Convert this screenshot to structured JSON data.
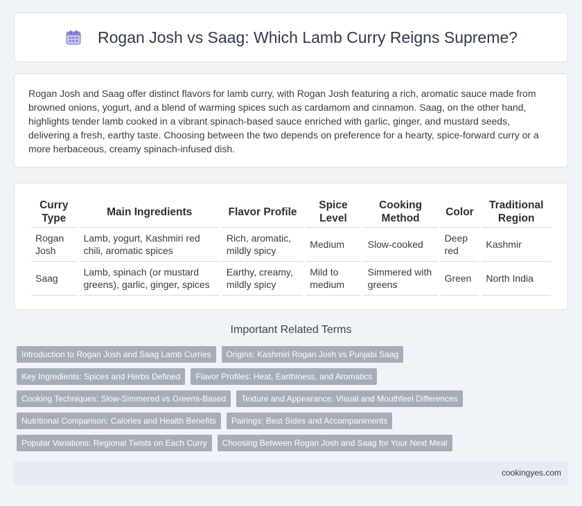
{
  "header": {
    "icon": "calendar-icon",
    "title": "Rogan Josh vs Saag: Which Lamb Curry Reigns Supreme?"
  },
  "intro": {
    "text": "Rogan Josh and Saag offer distinct flavors for lamb curry, with Rogan Josh featuring a rich, aromatic sauce made from browned onions, yogurt, and a blend of warming spices such as cardamom and cinnamon. Saag, on the other hand, highlights tender lamb cooked in a vibrant spinach-based sauce enriched with garlic, ginger, and mustard seeds, delivering a fresh, earthy taste. Choosing between the two depends on preference for a hearty, spice-forward curry or a more herbaceous, creamy spinach-infused dish."
  },
  "table": {
    "headers": [
      "Curry Type",
      "Main Ingredients",
      "Flavor Profile",
      "Spice Level",
      "Cooking Method",
      "Color",
      "Traditional Region"
    ],
    "rows": [
      [
        "Rogan Josh",
        "Lamb, yogurt, Kashmiri red chili, aromatic spices",
        "Rich, aromatic, mildly spicy",
        "Medium",
        "Slow-cooked",
        "Deep red",
        "Kashmir"
      ],
      [
        "Saag",
        "Lamb, spinach (or mustard greens), garlic, ginger, spices",
        "Earthy, creamy, mildly spicy",
        "Mild to medium",
        "Simmered with greens",
        "Green",
        "North India"
      ]
    ]
  },
  "related": {
    "title": "Important Related Terms",
    "rows": [
      [
        "Introduction to Rogan Josh and Saag Lamb Curries",
        "Origins: Kashmiri Rogan Josh vs Punjabi Saag"
      ],
      [
        "Key Ingredients: Spices and Herbs Defined",
        "Flavor Profiles: Heat, Earthiness, and Aromatics"
      ],
      [
        "Cooking Techniques: Slow-Simmered vs Greens-Based",
        "Texture and Appearance: Visual and Mouthfeel Differences"
      ],
      [
        "Nutritional Comparison: Calories and Health Benefits",
        "Pairings: Best Sides and Accompaniments"
      ],
      [
        "Popular Variations: Regional Twists on Each Curry",
        "Choosing Between Rogan Josh and Saag for Your Next Meal"
      ]
    ]
  },
  "footer": {
    "site": "cookingyes.com"
  }
}
